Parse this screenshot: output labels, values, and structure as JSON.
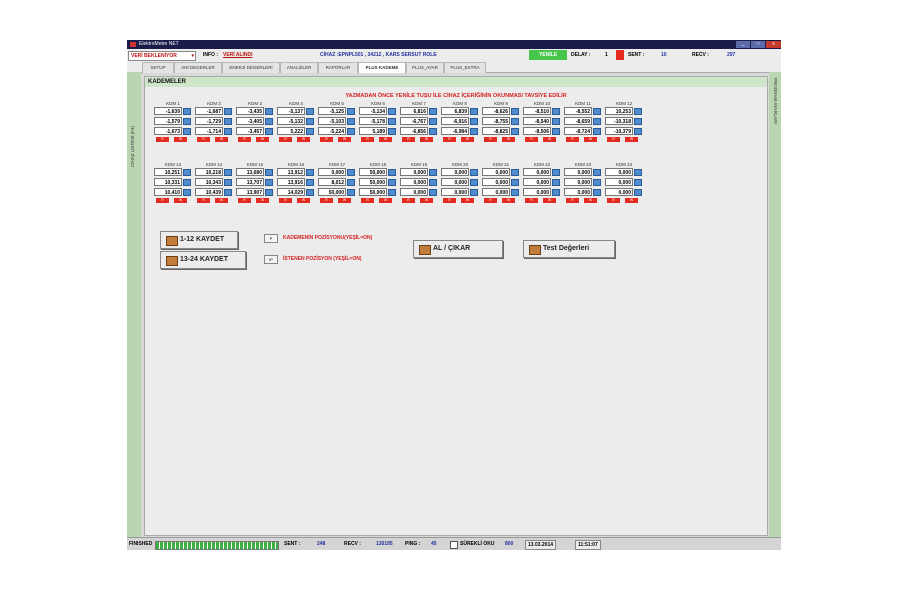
{
  "window": {
    "title": "ElektroMetre NET",
    "min": "_",
    "max": "□",
    "close": "x"
  },
  "toprow": {
    "status_select": "VERİ BEKLENİYOR",
    "info_label": "INFO :",
    "info_value": "VERİ ALINDI",
    "device": "CİHAZ :EPNPL501 , 34212 , KARS SERSUT ROLE",
    "yenile": "YENİLE",
    "delay_label": "DELAY :",
    "delay_value": "1",
    "sent_label": "SENT :",
    "sent_value": "10",
    "recv_label": "RECV :",
    "recv_value": "297",
    "colors": {
      "yenile_bg": "#46c64a",
      "recv": "#2330a0"
    }
  },
  "tabs": [
    "SETUP",
    "ANİ DEGERLER",
    "ENERJİ DEGERLERİ",
    "ANALİZLER",
    "RAPORLAR",
    "PLUS KADEME",
    "PLUS_AYAR",
    "PLUS_EXTRA"
  ],
  "active_tab": "PLUS KADEME",
  "sidebars": {
    "left": "CİHAZ LİSTESİ (F4)",
    "right": "PROGRAM AYARLARI"
  },
  "panel": {
    "title": "KADEMELER",
    "warning": "YAZMADAN ÖNCE YENİLE TUŞU İLE CİHAZ İÇERİĞİNİN OKUNMASI TAVSİYE EDİLİR"
  },
  "group1": {
    "labels": [
      "KDM 1",
      "KDM 2",
      "KDM 3",
      "KDM 4",
      "KDM 5",
      "KDM 6",
      "KDM 7",
      "KDM 8",
      "KDM 9",
      "KDM 10",
      "KDM 11",
      "KDM 12"
    ],
    "rows": [
      [
        "-1,639",
        "-1,687",
        "-3,435",
        "-5,137",
        "-5,125",
        "-5,134",
        "6,816",
        "6,839",
        "-8,626",
        "-8,510",
        "-8,552",
        "10,253"
      ],
      [
        "-1,579",
        "-1,729",
        "-3,405",
        "-5,132",
        "-5,103",
        "-5,178",
        "-6,767",
        "-6,916",
        "-8,755",
        "-8,540",
        "-8,659",
        "-10,318"
      ],
      [
        "-1,673",
        "-1,714",
        "-3,457",
        "5,222",
        "-5,224",
        "5,189",
        "-6,856",
        "-6,984",
        "-8,825",
        "-8,506",
        "-8,724",
        "-10,379"
      ]
    ]
  },
  "group2": {
    "labels": [
      "KDM 13",
      "KDM 14",
      "KDM 15",
      "KDM 16",
      "KDM 17",
      "KDM 18",
      "KDM 19",
      "KDM 20",
      "KDM 21",
      "KDM 22",
      "KDM 23",
      "KDM 24"
    ],
    "rows": [
      [
        "10,251",
        "10,218",
        "13,680",
        "13,912",
        "0,000",
        "50,000",
        "0,000",
        "0,000",
        "0,000",
        "0,000",
        "0,000",
        "0,000"
      ],
      [
        "10,331",
        "10,343",
        "13,707",
        "13,916",
        "8,012",
        "50,000",
        "0,000",
        "0,000",
        "0,000",
        "0,000",
        "0,000",
        "0,000"
      ],
      [
        "10,410",
        "10,439",
        "13,907",
        "14,029",
        "50,000",
        "50,000",
        "0,000",
        "0,000",
        "0,000",
        "0,000",
        "0,000",
        "0,000"
      ]
    ]
  },
  "red_buttons": [
    "R",
    "W"
  ],
  "buttons": {
    "save_1_12": "1-12 KAYDET",
    "save_13_24": "13-24 KAYDET",
    "take_insert": "AL / ÇIKAR",
    "test_values": "Test Değerleri"
  },
  "indicators": {
    "kademe_pos_btn": "P",
    "kademe_pos_text": "KADEMENİN POZİSYONU(YEŞİL=ON)",
    "istenen_pos_btn": "IP",
    "istenen_pos_text": "İSTENEN POZİSYON (YEŞİL=ON)"
  },
  "statusbar": {
    "state": "FINISHED",
    "progress": 1.0,
    "sent_label": "SENT :",
    "sent_value": "248",
    "recv_label": "RECV :",
    "recv_value": "130195",
    "ping_label": "PING :",
    "ping_value": "45",
    "continuous_label": "SÜREKLİ OKU",
    "continuous_value": "800",
    "date": "13.03.2014",
    "time": "11:51:07"
  }
}
